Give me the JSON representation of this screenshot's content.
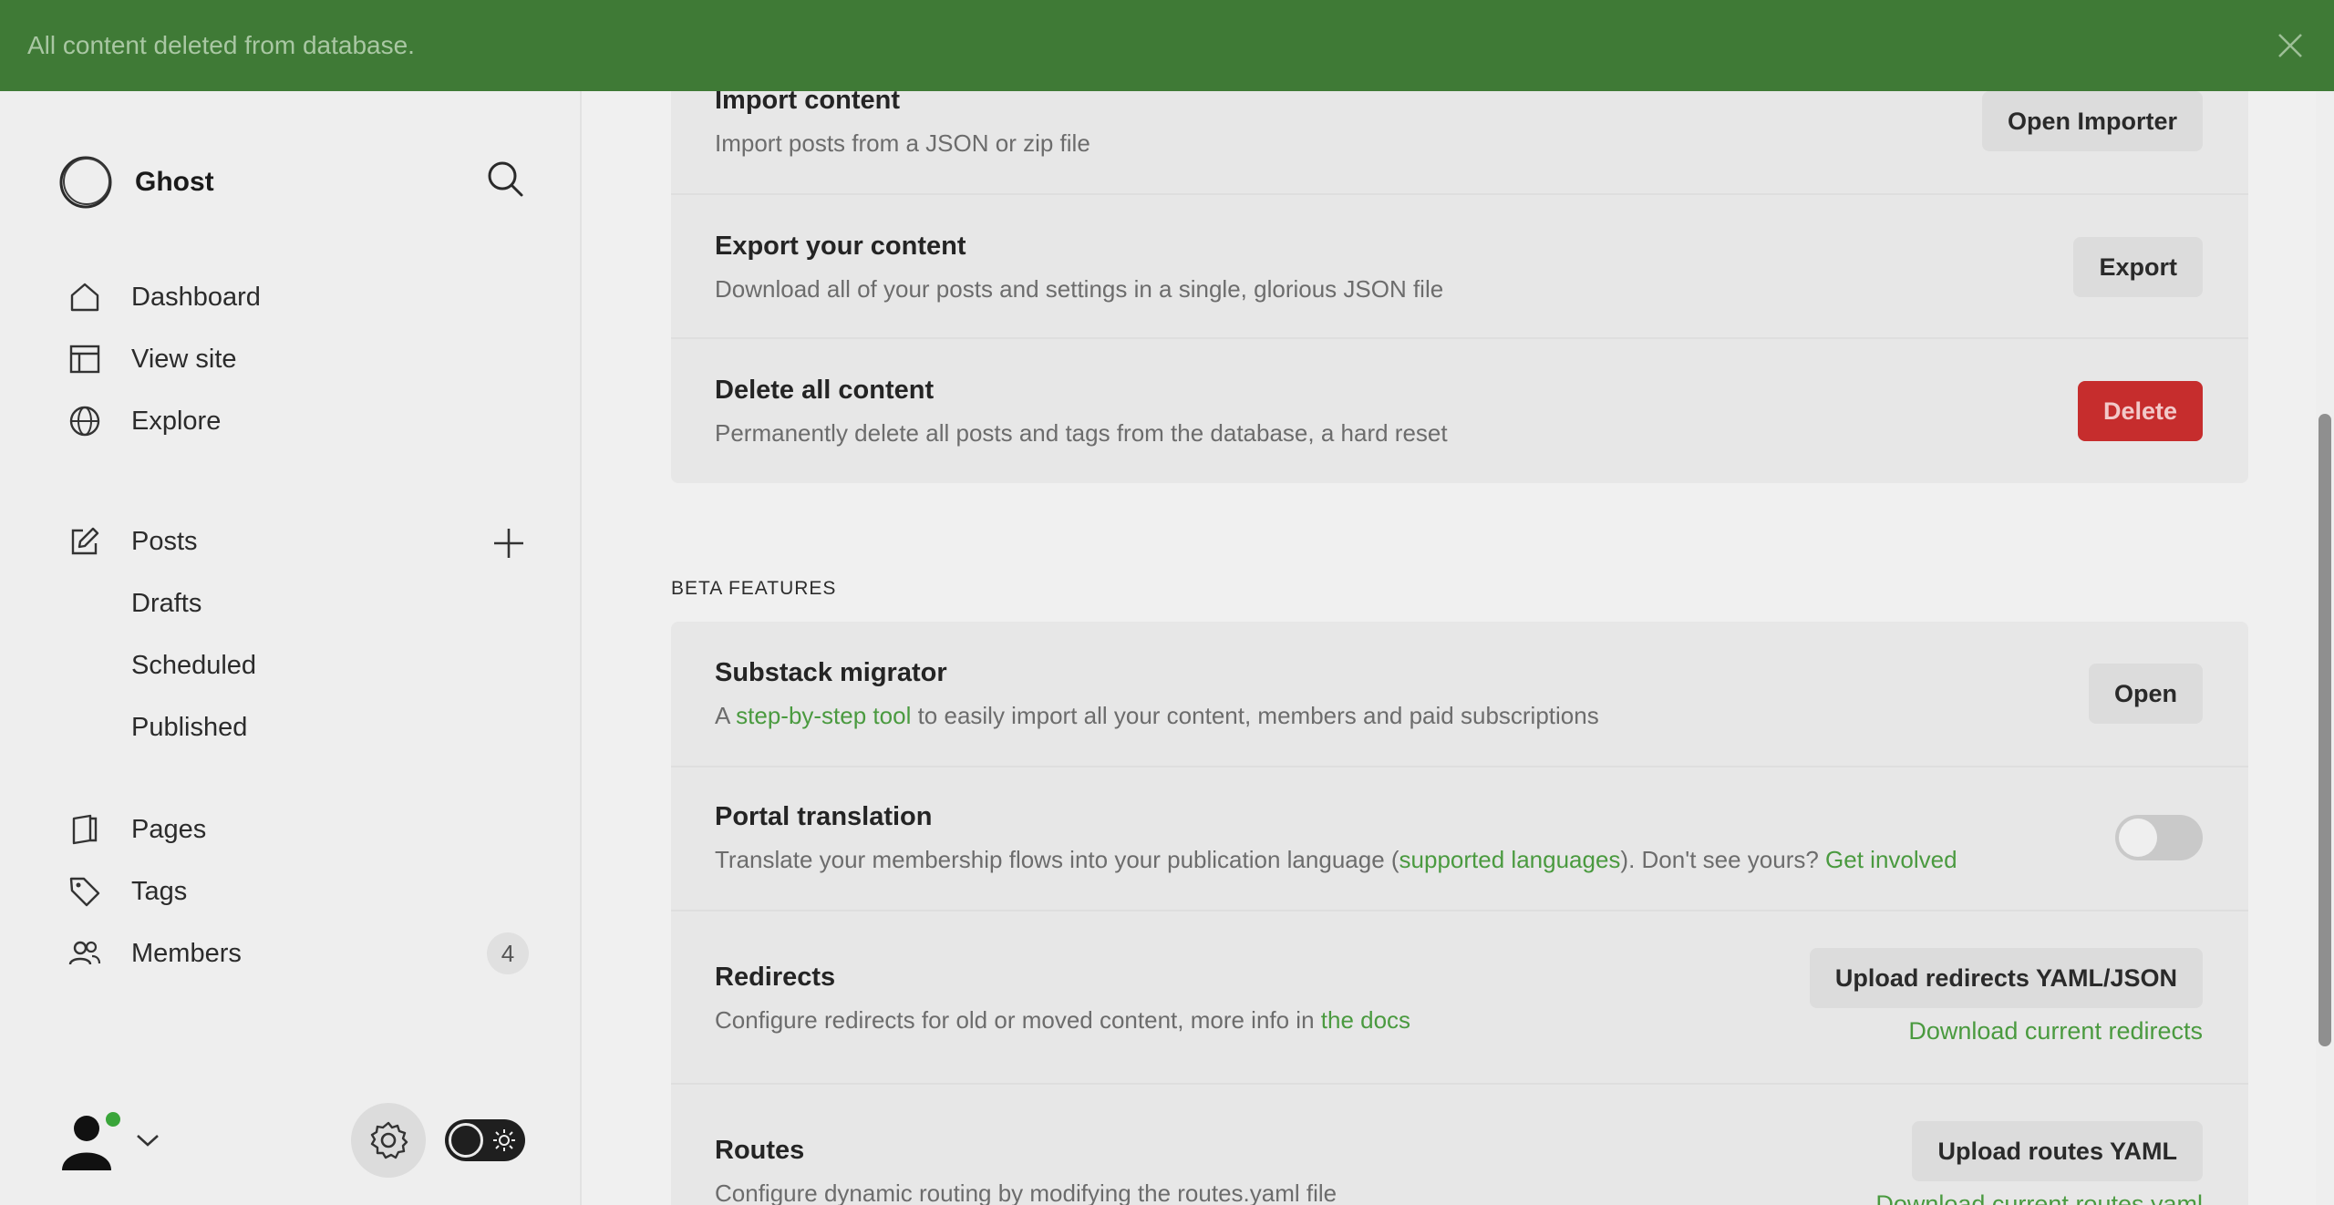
{
  "notification": {
    "text": "All content deleted from database."
  },
  "sidebar": {
    "brand": "Ghost",
    "nav": [
      {
        "label": "Dashboard",
        "icon": "home-icon"
      },
      {
        "label": "View site",
        "icon": "layout-icon"
      },
      {
        "label": "Explore",
        "icon": "globe-icon"
      }
    ],
    "posts": {
      "label": "Posts",
      "icon": "pencil-icon",
      "sub": [
        "Drafts",
        "Scheduled",
        "Published"
      ]
    },
    "lower_nav": [
      {
        "label": "Pages",
        "icon": "pages-icon"
      },
      {
        "label": "Tags",
        "icon": "tag-icon"
      },
      {
        "label": "Members",
        "icon": "members-icon",
        "count": "4"
      }
    ]
  },
  "main": {
    "import": {
      "title": "Import content",
      "desc": "Import posts from a JSON or zip file",
      "button": "Open Importer"
    },
    "export": {
      "title": "Export your content",
      "desc": "Download all of your posts and settings in a single, glorious JSON file",
      "button": "Export"
    },
    "delete": {
      "title": "Delete all content",
      "desc": "Permanently delete all posts and tags from the database, a hard reset",
      "button": "Delete"
    },
    "beta_label": "BETA FEATURES",
    "substack": {
      "title": "Substack migrator",
      "desc_prefix": "A ",
      "desc_link": "step-by-step tool",
      "desc_suffix": " to easily import all your content, members and paid subscriptions",
      "button": "Open"
    },
    "portal": {
      "title": "Portal translation",
      "desc_prefix": "Translate your membership flows into your publication language (",
      "desc_link1": "supported languages",
      "desc_mid": "). Don't see yours? ",
      "desc_link2": "Get involved",
      "enabled": false
    },
    "redirects": {
      "title": "Redirects",
      "desc_prefix": "Configure redirects for old or moved content, more info in ",
      "desc_link": "the docs",
      "button": "Upload redirects YAML/JSON",
      "download": "Download current redirects"
    },
    "routes": {
      "title": "Routes",
      "desc": "Configure dynamic routing by modifying the routes.yaml file",
      "button": "Upload routes YAML",
      "download": "Download current routes.yaml"
    }
  },
  "colors": {
    "banner": "#3f7a36",
    "accent": "#4a9a3f",
    "danger": "#c62d2d"
  }
}
